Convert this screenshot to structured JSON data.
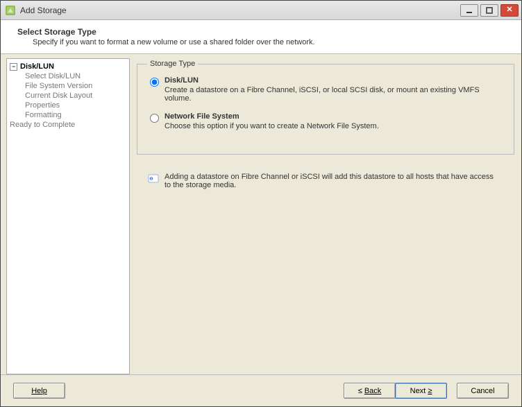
{
  "window": {
    "title": "Add Storage"
  },
  "header": {
    "title": "Select Storage Type",
    "description": "Specify if you want to format a new volume or use a shared folder over the network."
  },
  "sidebar": {
    "root": {
      "label": "Disk/LUN",
      "expanded": true
    },
    "children": [
      {
        "label": "Select Disk/LUN"
      },
      {
        "label": "File System Version"
      },
      {
        "label": "Current Disk Layout"
      },
      {
        "label": "Properties"
      },
      {
        "label": "Formatting"
      }
    ],
    "ready": {
      "label": "Ready to Complete"
    }
  },
  "storage_type": {
    "legend": "Storage Type",
    "options": [
      {
        "id": "disk_lun",
        "selected": true,
        "title": "Disk/LUN",
        "desc": "Create a datastore on a Fibre Channel, iSCSI, or local SCSI disk, or mount an existing VMFS volume."
      },
      {
        "id": "nfs",
        "selected": false,
        "title": "Network File System",
        "desc": "Choose this option if you want to create a Network File System."
      }
    ],
    "hint": "Adding a datastore on Fibre Channel or iSCSI will add this datastore to all hosts that have access to the storage media."
  },
  "buttons": {
    "help": "Help",
    "back_pre": "≤ ",
    "back_txt": "Back",
    "next_txt": "Next ",
    "next_post": "≥",
    "cancel": "Cancel"
  }
}
